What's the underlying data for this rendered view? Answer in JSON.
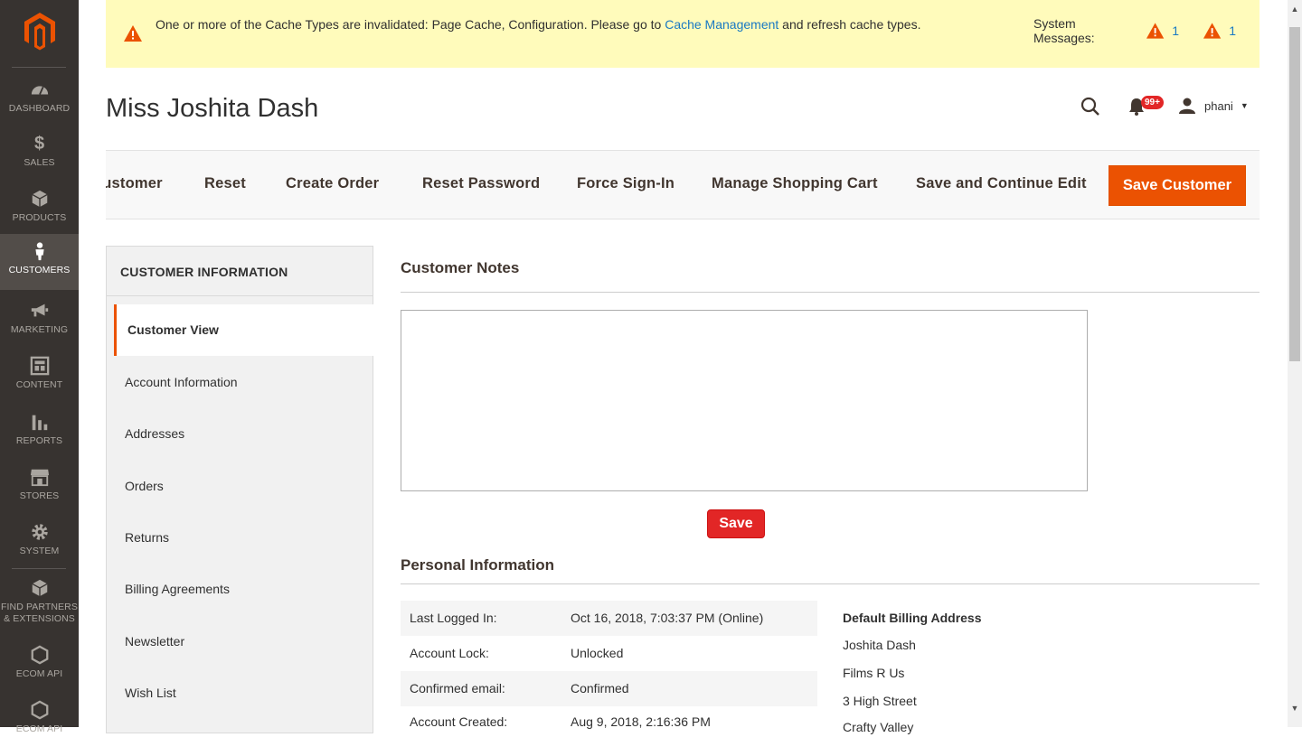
{
  "sidebar": {
    "items": [
      {
        "label": "DASHBOARD",
        "icon": "dashboard-icon"
      },
      {
        "label": "SALES",
        "icon": "dollar-icon"
      },
      {
        "label": "PRODUCTS",
        "icon": "cube-icon"
      },
      {
        "label": "CUSTOMERS",
        "icon": "person-icon",
        "active": true
      },
      {
        "label": "MARKETING",
        "icon": "megaphone-icon"
      },
      {
        "label": "CONTENT",
        "icon": "layout-icon"
      },
      {
        "label": "REPORTS",
        "icon": "bar-chart-icon"
      },
      {
        "label": "STORES",
        "icon": "store-icon"
      },
      {
        "label": "SYSTEM",
        "icon": "gear-icon"
      },
      {
        "label": "FIND PARTNERS & EXTENSIONS",
        "icon": "box-icon"
      },
      {
        "label": "ECOM API",
        "icon": "hexagon-icon"
      },
      {
        "label": "ECOM API",
        "icon": "hexagon-icon"
      }
    ]
  },
  "message": {
    "text_before": "One or more of the Cache Types are invalidated: Page Cache, Configuration. Please go to ",
    "link": "Cache Management",
    "text_after": " and refresh cache types.",
    "system_label": "System Messages:",
    "count_1": "1",
    "count_2": "1"
  },
  "header": {
    "title": "Miss Joshita Dash",
    "badge": "99+",
    "user": "phani"
  },
  "toolbar": {
    "delete": "e Customer",
    "reset": "Reset",
    "create_order": "Create Order",
    "reset_password": "Reset Password",
    "force_signin": "Force Sign-In",
    "manage_cart": "Manage Shopping Cart",
    "save_continue": "Save and Continue Edit",
    "save": "Save Customer"
  },
  "tabs": {
    "title": "CUSTOMER INFORMATION",
    "items": [
      "Customer View",
      "Account Information",
      "Addresses",
      "Orders",
      "Returns",
      "Billing Agreements",
      "Newsletter",
      "Wish List"
    ]
  },
  "notes": {
    "title": "Customer Notes",
    "value": "",
    "save": "Save"
  },
  "personal": {
    "title": "Personal Information",
    "rows": [
      {
        "k": "Last Logged In:",
        "v": "Oct 16, 2018, 7:03:37 PM (Online)"
      },
      {
        "k": "Account Lock:",
        "v": "Unlocked"
      },
      {
        "k": "Confirmed email:",
        "v": "Confirmed"
      },
      {
        "k": "Account Created:",
        "v": "Aug 9, 2018, 2:16:36 PM"
      }
    ]
  },
  "billing": {
    "title": "Default Billing Address",
    "lines": [
      "Joshita Dash",
      "Films R Us",
      "3 High Street",
      "Crafty Valley"
    ]
  },
  "colors": {
    "accent": "#eb5202",
    "sidebar": "#373330",
    "message_bg": "#fffbbb",
    "link": "#1979c3"
  }
}
